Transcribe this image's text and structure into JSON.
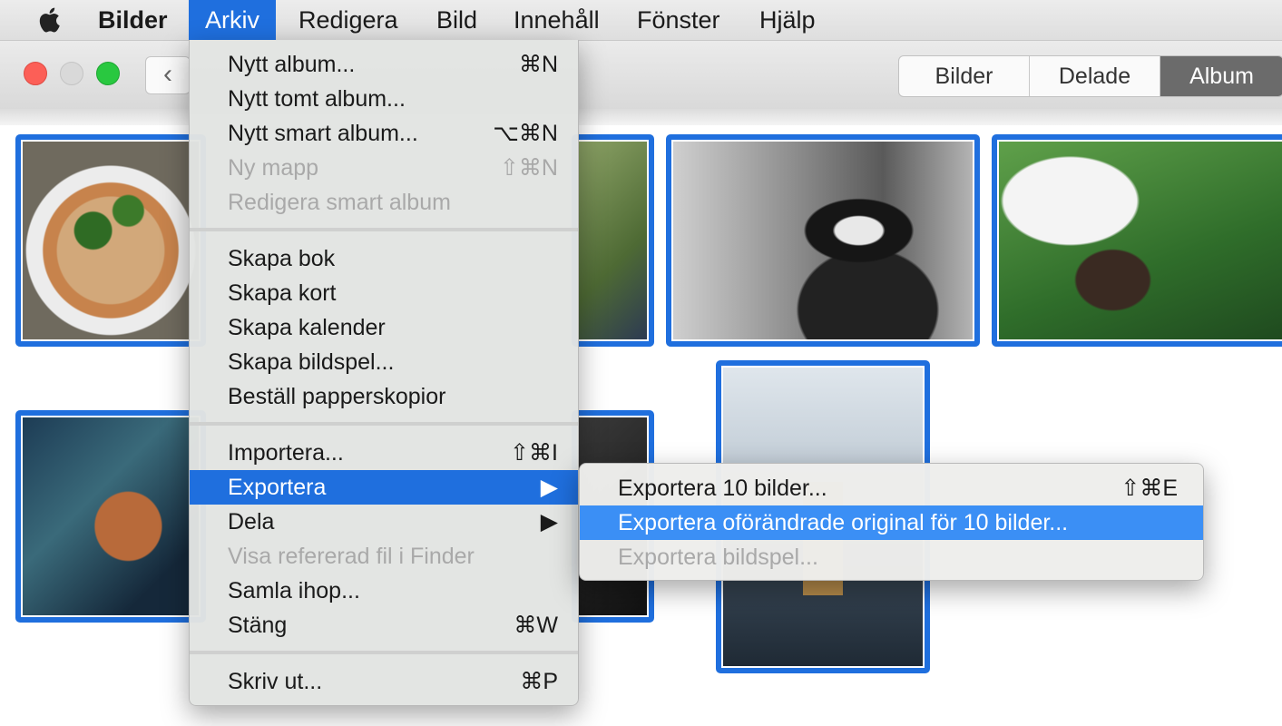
{
  "menubar": {
    "app_name": "Bilder",
    "items": [
      "Arkiv",
      "Redigera",
      "Bild",
      "Innehåll",
      "Fönster",
      "Hjälp"
    ],
    "active": "Arkiv"
  },
  "toolbar": {
    "back_glyph": "‹",
    "segments": [
      "Bilder",
      "Delade",
      "Album"
    ],
    "selected_segment": "Album"
  },
  "file_menu": {
    "items": [
      {
        "label": "Nytt album...",
        "shortcut": "⌘N",
        "enabled": true
      },
      {
        "label": "Nytt tomt album...",
        "shortcut": "",
        "enabled": true
      },
      {
        "label": "Nytt smart album...",
        "shortcut": "⌥⌘N",
        "enabled": true
      },
      {
        "label": "Ny mapp",
        "shortcut": "⇧⌘N",
        "enabled": false
      },
      {
        "label": "Redigera smart album",
        "shortcut": "",
        "enabled": false
      },
      {
        "label": "Skapa bok",
        "shortcut": "",
        "enabled": true
      },
      {
        "label": "Skapa kort",
        "shortcut": "",
        "enabled": true
      },
      {
        "label": "Skapa kalender",
        "shortcut": "",
        "enabled": true
      },
      {
        "label": "Skapa bildspel...",
        "shortcut": "",
        "enabled": true
      },
      {
        "label": "Beställ papperskopior",
        "shortcut": "",
        "enabled": true
      },
      {
        "label": "Importera...",
        "shortcut": "⇧⌘I",
        "enabled": true
      },
      {
        "label": "Exportera",
        "shortcut": "▶",
        "enabled": true,
        "highlighted": true
      },
      {
        "label": "Dela",
        "shortcut": "▶",
        "enabled": true
      },
      {
        "label": "Visa refererad fil i Finder",
        "shortcut": "",
        "enabled": false
      },
      {
        "label": "Samla ihop...",
        "shortcut": "",
        "enabled": true
      },
      {
        "label": "Stäng",
        "shortcut": "⌘W",
        "enabled": true
      },
      {
        "label": "Skriv ut...",
        "shortcut": "⌘P",
        "enabled": true
      }
    ]
  },
  "export_submenu": {
    "items": [
      {
        "label": "Exportera 10 bilder...",
        "shortcut": "⇧⌘E",
        "enabled": true
      },
      {
        "label": "Exportera oförändrade original för 10 bilder...",
        "shortcut": "",
        "enabled": true,
        "highlighted": true
      },
      {
        "label": "Exportera bildspel...",
        "shortcut": "",
        "enabled": false
      }
    ]
  },
  "photos": [
    "pizza",
    "grass-shoes",
    "bw-portrait",
    "lawn-portrait",
    "fern",
    "dark-photo",
    "lake-pier"
  ],
  "colors": {
    "selection": "#1f6fde",
    "submenu_highlight": "#3b8ff5"
  }
}
